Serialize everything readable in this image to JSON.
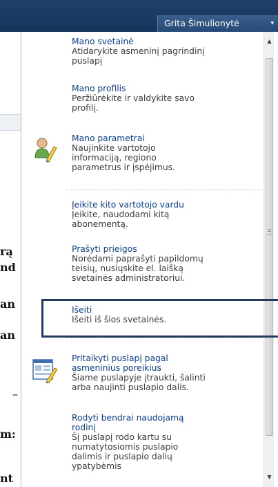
{
  "header": {
    "user_name": "Grita Šimulionytė",
    "caret": "▾"
  },
  "background_fragments": [
    "rą",
    "nd",
    "an",
    "an",
    "–",
    "m:",
    "nt"
  ],
  "menu": {
    "items": [
      {
        "title": "Mano svetainė",
        "lines": [
          "Atidarykite asmeninį pagrindinį",
          "puslapį"
        ]
      },
      {
        "title": "Mano profilis",
        "lines": [
          "Peržiūrėkite ir valdykite savo",
          "profilį."
        ]
      },
      {
        "title": "Mano parametrai",
        "lines": [
          "Naujinkite vartotojo",
          "informaciją, regiono",
          "parametrus ir įspėjimus."
        ]
      },
      {
        "title": "Įeikite kito vartotojo vardu",
        "lines": [
          "Įeikite, naudodami kitą",
          "abonementą."
        ]
      },
      {
        "title": "Prašyti prieigos",
        "lines": [
          "Norėdami paprašyti papildomų",
          "teisių, nusiųskite el. laišką",
          "svetainės administratoriui."
        ]
      },
      {
        "title": "Išeiti",
        "lines": [
          "Išeiti iš šios svetainės."
        ]
      },
      {
        "title_lines": [
          "Pritaikyti puslapį pagal",
          "asmeninius poreikius"
        ],
        "lines": [
          "Šiame puslapyje įtraukti, šalinti",
          "arba naujinti puslapio dalis."
        ]
      },
      {
        "title_lines": [
          "Rodyti bendrai naudojamą",
          "rodinį"
        ],
        "lines": [
          "Šį puslapį rodo kartu su",
          "numatytosiomis puslapio",
          "dalimis ir puslapio dalių",
          "ypatybėmis"
        ]
      }
    ]
  },
  "scrollbar": {
    "up": "▲",
    "down": "▼"
  },
  "colors": {
    "header_bg": "#17355c",
    "link": "#0a3d91",
    "highlight": "#243a5e"
  }
}
